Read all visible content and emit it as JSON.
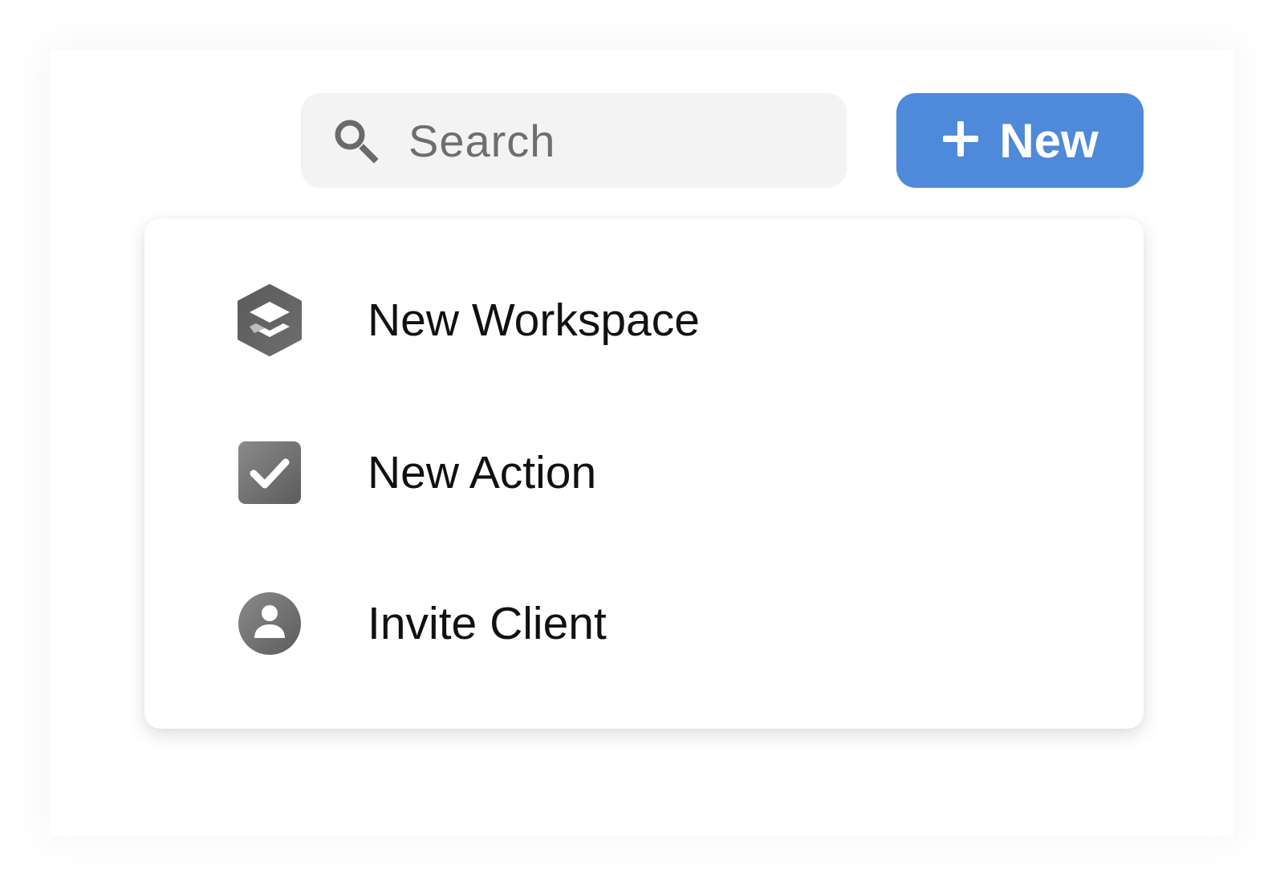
{
  "search": {
    "placeholder": "Search",
    "icon": "search-icon"
  },
  "new_button": {
    "label": "New",
    "icon": "plus-icon",
    "color": "#4f89d9"
  },
  "menu": {
    "items": [
      {
        "label": "New Workspace",
        "icon": "workspace-layers-icon"
      },
      {
        "label": "New Action",
        "icon": "checkbox-check-icon"
      },
      {
        "label": "Invite Client",
        "icon": "user-avatar-icon"
      }
    ]
  }
}
